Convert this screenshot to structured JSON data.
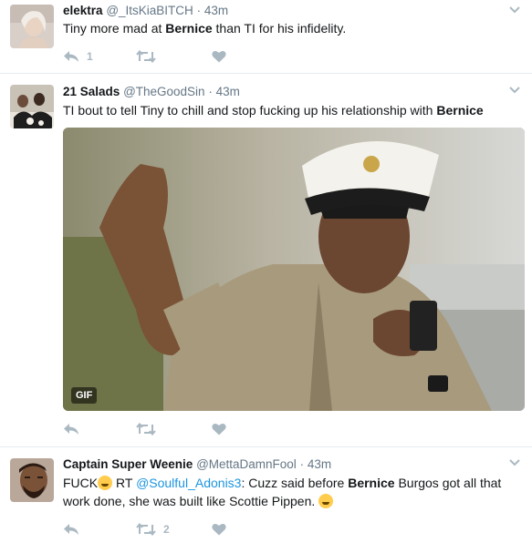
{
  "tweets": [
    {
      "name": "elektra",
      "handle": "@_ItsKiaBITCH",
      "time": "43m",
      "text_before": "Tiny more mad at ",
      "highlight": "Bernice",
      "text_after": " than TI for his infidelity.",
      "reply_count": "1",
      "retweet_count": "",
      "like_count": ""
    },
    {
      "name": "21 Salads",
      "handle": "@TheGoodSin",
      "time": "43m",
      "text_before": "TI bout to tell Tiny to chill and stop fucking up his relationship with ",
      "highlight": "Bernice",
      "text_after": "",
      "media_badge": "GIF",
      "reply_count": "",
      "retweet_count": "",
      "like_count": ""
    },
    {
      "name": "Captain Super Weenie",
      "handle": "@MettaDamnFool",
      "time": "43m",
      "text_1": "FUCK",
      "text_2": " RT ",
      "mention": "@Soulful_Adonis3",
      "text_3": ": Cuzz said before ",
      "highlight": "Bernice",
      "text_4": " Burgos got all that work done, she was built like Scottie Pippen. ",
      "reply_count": "",
      "retweet_count": "2",
      "like_count": ""
    }
  ],
  "separator": "·",
  "icons": {
    "reply": "reply-icon",
    "retweet": "retweet-icon",
    "like": "heart-icon",
    "more": "chevron-down-icon"
  },
  "colors": {
    "link": "#1b95e0",
    "secondary_text": "#657786",
    "action_icon": "#aab8c2",
    "divider": "#e6ecf0"
  }
}
